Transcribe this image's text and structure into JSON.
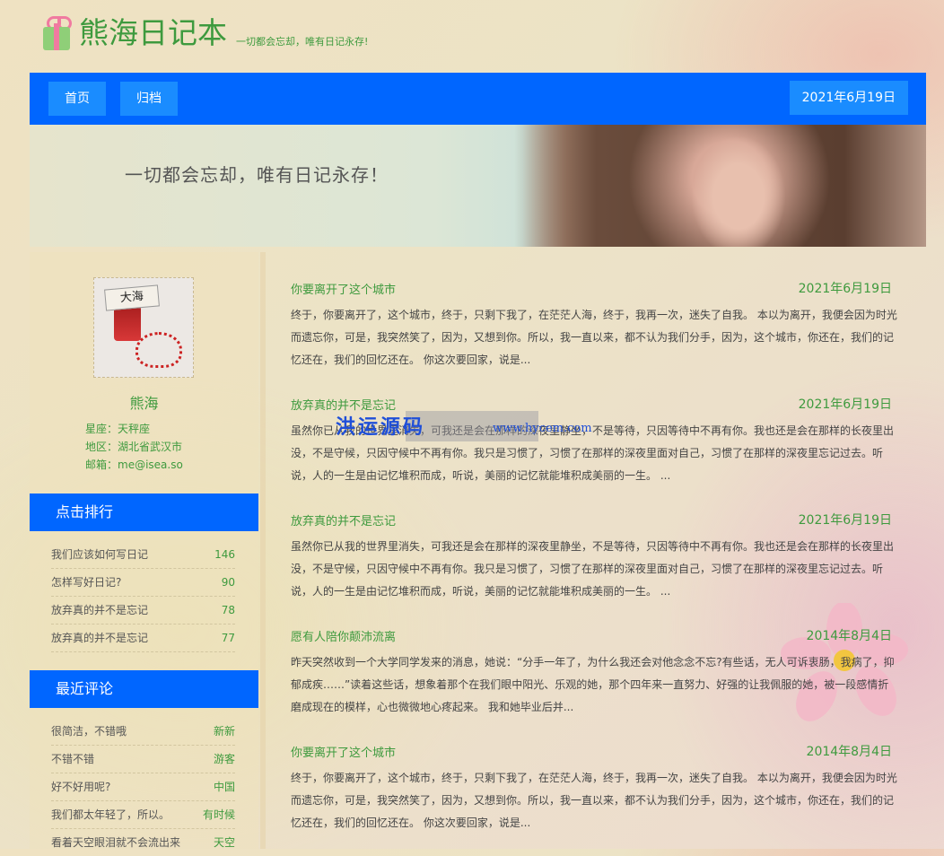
{
  "header": {
    "title": "熊海日记本",
    "motto": "一切都会忘却，唯有日记永存!"
  },
  "nav": {
    "home": "首页",
    "archive": "归档",
    "date": "2021年6月19日"
  },
  "banner": {
    "text": "一切都会忘却，唯有日记永存！"
  },
  "profile": {
    "avatar_text": "大海",
    "name": "熊海",
    "rows": [
      "星座：天秤座",
      "地区：湖北省武汉市",
      "邮箱：me@isea.so"
    ]
  },
  "ranking": {
    "title": "点击排行",
    "items": [
      {
        "label": "我们应该如何写日记",
        "value": "146"
      },
      {
        "label": "怎样写好日记?",
        "value": "90"
      },
      {
        "label": "放弃真的并不是忘记",
        "value": "78"
      },
      {
        "label": "放弃真的并不是忘记",
        "value": "77"
      }
    ]
  },
  "comments": {
    "title": "最近评论",
    "items": [
      {
        "label": "很简洁，不错哦",
        "value": "新新"
      },
      {
        "label": "不错不错",
        "value": "游客"
      },
      {
        "label": "好不好用呢?",
        "value": "中国"
      },
      {
        "label": "我们都太年轻了，所以。",
        "value": "有时候"
      },
      {
        "label": "看着天空眼泪就不会流出来",
        "value": "天空"
      }
    ]
  },
  "posts": [
    {
      "title": "你要离开了这个城市",
      "date": "2021年6月19日",
      "body": "终于，你要离开了，这个城市，终于，只剩下我了，在茫茫人海，终于，我再一次，迷失了自我。 本以为离开，我便会因为时光而遗忘你，可是，我突然笑了，因为，又想到你。所以，我一直以来，都不认为我们分手，因为，这个城市，你还在，我们的记忆还在，我们的回忆还在。 你这次要回家，说是..."
    },
    {
      "title": "放弃真的并不是忘记",
      "date": "2021年6月19日",
      "body": "虽然你已从我的世界里消失，可我还是会在那样的深夜里静坐，不是等待，只因等待中不再有你。我也还是会在那样的长夜里出没，不是守候，只因守候中不再有你。我只是习惯了，习惯了在那样的深夜里面对自己，习惯了在那样的深夜里忘记过去。听说，人的一生是由记忆堆积而成，听说，美丽的记忆就能堆积成美丽的一生。 ..."
    },
    {
      "title": "放弃真的并不是忘记",
      "date": "2021年6月19日",
      "body": "虽然你已从我的世界里消失，可我还是会在那样的深夜里静坐，不是等待，只因等待中不再有你。我也还是会在那样的长夜里出没，不是守候，只因守候中不再有你。我只是习惯了，习惯了在那样的深夜里面对自己，习惯了在那样的深夜里忘记过去。听说，人的一生是由记忆堆积而成，听说，美丽的记忆就能堆积成美丽的一生。 ..."
    },
    {
      "title": "愿有人陪你颠沛流离",
      "date": "2014年8月4日",
      "body": "昨天突然收到一个大学同学发来的消息，她说：“分手一年了，为什么我还会对他念念不忘?有些话，无人可诉衷肠，我病了，抑郁成疾……”读着这些话，想象着那个在我们眼中阳光、乐观的她，那个四年来一直努力、好强的让我佩服的她，被一段感情折磨成现在的模样，心也微微地心疼起来。 我和她毕业后并..."
    },
    {
      "title": "你要离开了这个城市",
      "date": "2014年8月4日",
      "body": "终于，你要离开了，这个城市，终于，只剩下我了，在茫茫人海，终于，我再一次，迷失了自我。 本以为离开，我便会因为时光而遗忘你，可是，我突然笑了，因为，又想到你。所以，我一直以来，都不认为我们分手，因为，这个城市，你还在，我们的记忆还在，我们的回忆还在。 你这次要回家，说是..."
    }
  ],
  "watermark": {
    "text": "洪运源码",
    "url": "www.hycem.com"
  }
}
